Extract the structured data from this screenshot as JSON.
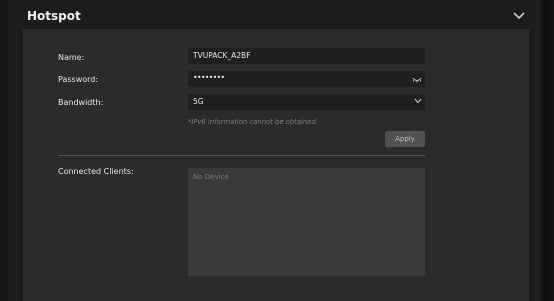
{
  "header": {
    "title": "Hotspot"
  },
  "form": {
    "name_label": "Name:",
    "name_value": "TVUPACK_A2BF",
    "password_label": "Password:",
    "password_mask": "••••••••",
    "bandwidth_label": "Bandwidth:",
    "bandwidth_value": "5G",
    "ipv6_note": "*IPv6 information cannot be obtained.",
    "apply_label": "Apply"
  },
  "clients": {
    "label": "Connected Clients:",
    "empty_text": "No Device"
  },
  "icons": {
    "collapse": "chevron-down-icon",
    "password_toggle": "eye-icon",
    "bandwidth_dropdown": "chevron-down-icon"
  }
}
